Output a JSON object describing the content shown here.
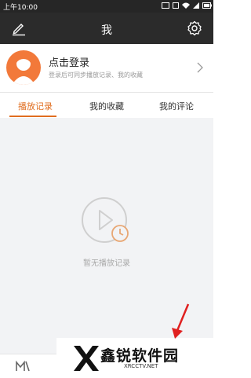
{
  "status": {
    "time": "上午10:00"
  },
  "header": {
    "title": "我"
  },
  "profile": {
    "login_title": "点击登录",
    "login_subtitle": "登录后可同步播放记录、我的收藏"
  },
  "tabs": [
    {
      "label": "播放记录"
    },
    {
      "label": "我的收藏"
    },
    {
      "label": "我的评论"
    }
  ],
  "empty": {
    "text": "暂无播放记录"
  },
  "watermark": {
    "title": "鑫锐软件园",
    "subtitle": "XRCCTV.NET"
  },
  "colors": {
    "accent": "#e06d1f",
    "header_bg": "#2b2b2b",
    "content_bg": "#f2f3f5",
    "avatar": "#f2793a"
  }
}
